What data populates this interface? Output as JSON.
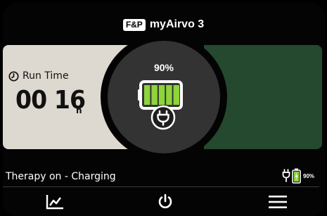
{
  "header": {
    "brand_logo": "F&P",
    "title": "myAirvo 3"
  },
  "run_time": {
    "label": "Run Time",
    "value": "00 16",
    "unit": "h",
    "icon": "clock-icon"
  },
  "battery": {
    "percent_label": "90%",
    "level": 0.9,
    "charging": true,
    "fill_color": "#8ed43c"
  },
  "status": {
    "text": "Therapy on - Charging",
    "battery_percent": "90%"
  },
  "nav": {
    "items": [
      {
        "icon": "chart-trend-icon"
      },
      {
        "icon": "power-icon"
      },
      {
        "icon": "menu-icon"
      }
    ]
  },
  "colors": {
    "left_panel": "#ddd9d0",
    "right_panel": "#24492e",
    "dial": "#333333",
    "background": "#040404"
  }
}
